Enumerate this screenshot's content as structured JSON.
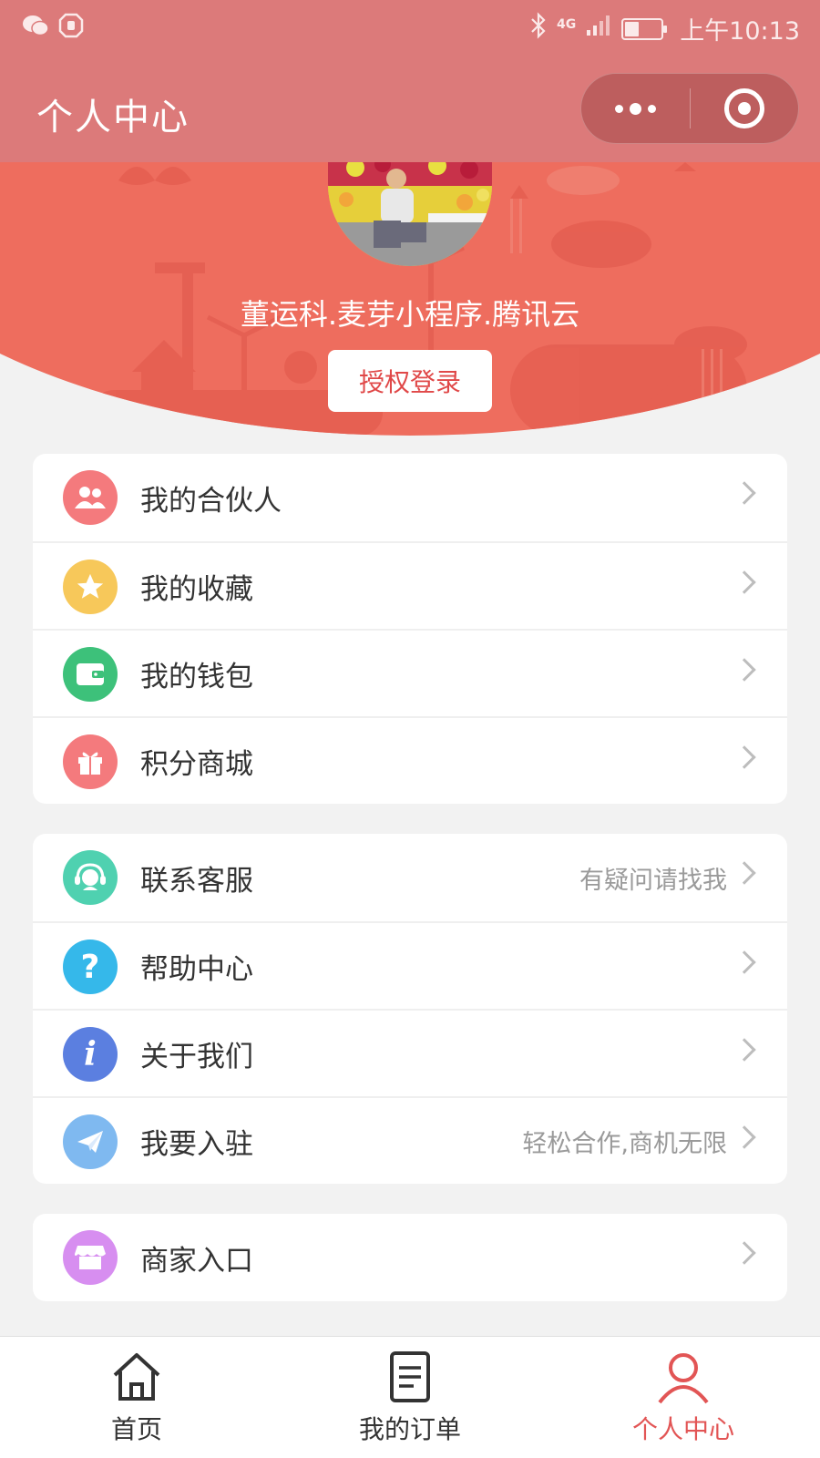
{
  "status_bar": {
    "time": "上午10:13",
    "network": "4G",
    "battery_level": 0.4,
    "left_icons": [
      "wechat-icon",
      "hand-icon"
    ],
    "right_icons": [
      "bluetooth-icon",
      "signal-icon",
      "battery-icon"
    ]
  },
  "header": {
    "title": "个人中心",
    "capsule_icons": [
      "more-dots-icon",
      "close-target-icon"
    ]
  },
  "profile": {
    "username": "董运科.麦芽小程序.腾讯云",
    "login_button": "授权登录"
  },
  "menu_groups": [
    {
      "items": [
        {
          "label": "我的合伙人",
          "icon": "partners-icon",
          "color": "#f47a7d"
        },
        {
          "label": "我的收藏",
          "icon": "star-icon",
          "color": "#f7c85a"
        },
        {
          "label": "我的钱包",
          "icon": "wallet-icon",
          "color": "#3dc17a"
        },
        {
          "label": "积分商城",
          "icon": "gift-icon",
          "color": "#f47a7d"
        }
      ]
    },
    {
      "items": [
        {
          "label": "联系客服",
          "hint": "有疑问请找我",
          "icon": "customer-service-icon",
          "color": "#4fd1b0"
        },
        {
          "label": "帮助中心",
          "icon": "question-icon",
          "color": "#35b8ea"
        },
        {
          "label": "关于我们",
          "icon": "info-icon",
          "color": "#5b7fe0"
        },
        {
          "label": "我要入驻",
          "hint": "轻松合作,商机无限",
          "icon": "paper-plane-icon",
          "color": "#7fb9f0"
        }
      ]
    },
    {
      "items": [
        {
          "label": "商家入口",
          "icon": "store-icon",
          "color": "#d78ef0"
        }
      ]
    }
  ],
  "tabbar": {
    "tabs": [
      {
        "label": "首页",
        "icon": "home-icon"
      },
      {
        "label": "我的订单",
        "icon": "order-icon"
      },
      {
        "label": "个人中心",
        "icon": "user-icon"
      }
    ],
    "active_color": "#e25555"
  }
}
